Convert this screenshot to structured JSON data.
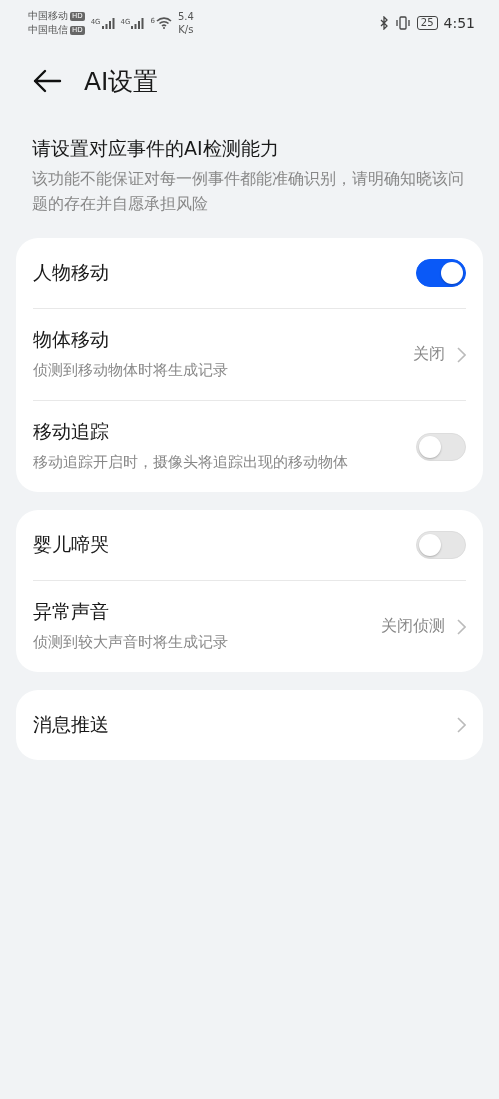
{
  "status_bar": {
    "carriers": [
      {
        "name": "中国移动",
        "badge": "HD"
      },
      {
        "name": "中国电信",
        "badge": "HD"
      }
    ],
    "signals": [
      {
        "label": "4G"
      },
      {
        "label": "4G"
      }
    ],
    "wifi_label": "6",
    "speed": "5.4",
    "speed_unit": "K/s",
    "battery": "25",
    "time": "4:51"
  },
  "header": {
    "title": "AI设置"
  },
  "intro": {
    "title": "请设置对应事件的AI检测能力",
    "text": "该功能不能保证对每一例事件都能准确识别，请明确知晓该问题的存在并自愿承担风险"
  },
  "groups": [
    {
      "rows": [
        {
          "kind": "toggle",
          "title": "人物移动",
          "on": true
        },
        {
          "kind": "link",
          "title": "物体移动",
          "subtitle": "侦测到移动物体时将生成记录",
          "value": "关闭"
        },
        {
          "kind": "toggle",
          "title": "移动追踪",
          "subtitle": "移动追踪开启时，摄像头将追踪出现的移动物体",
          "on": false
        }
      ]
    },
    {
      "rows": [
        {
          "kind": "toggle",
          "title": "婴儿啼哭",
          "on": false
        },
        {
          "kind": "link",
          "title": "异常声音",
          "subtitle": "侦测到较大声音时将生成记录",
          "value": "关闭侦测"
        }
      ]
    },
    {
      "rows": [
        {
          "kind": "link",
          "title": "消息推送"
        }
      ]
    }
  ]
}
